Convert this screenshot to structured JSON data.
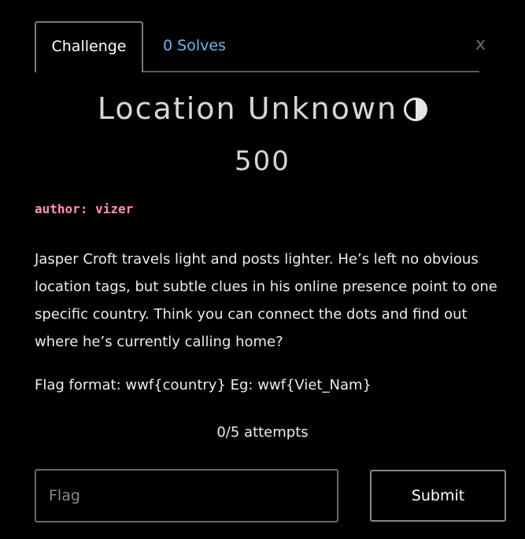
{
  "tabs": {
    "challenge_label": "Challenge",
    "solves_label": "0 Solves"
  },
  "close_label": "x",
  "challenge": {
    "title": "Location Unknown",
    "difficulty_icon": "half-circle-icon",
    "points": "500",
    "author": "author: vizer",
    "description": "Jasper Croft travels light and posts lighter. He’s left no obvious location tags, but subtle clues in his online presence point to one specific country. Think you can connect the dots and find out where he’s currently calling home?",
    "flag_format": "Flag format: wwf{country} Eg: wwf{Viet_Nam}",
    "attempts": "0/5 attempts"
  },
  "form": {
    "flag_placeholder": "Flag",
    "flag_value": "",
    "submit_label": "Submit"
  },
  "colors": {
    "background": "#000000",
    "solves_link": "#6fb8f0",
    "author": "#ff8fb9"
  }
}
